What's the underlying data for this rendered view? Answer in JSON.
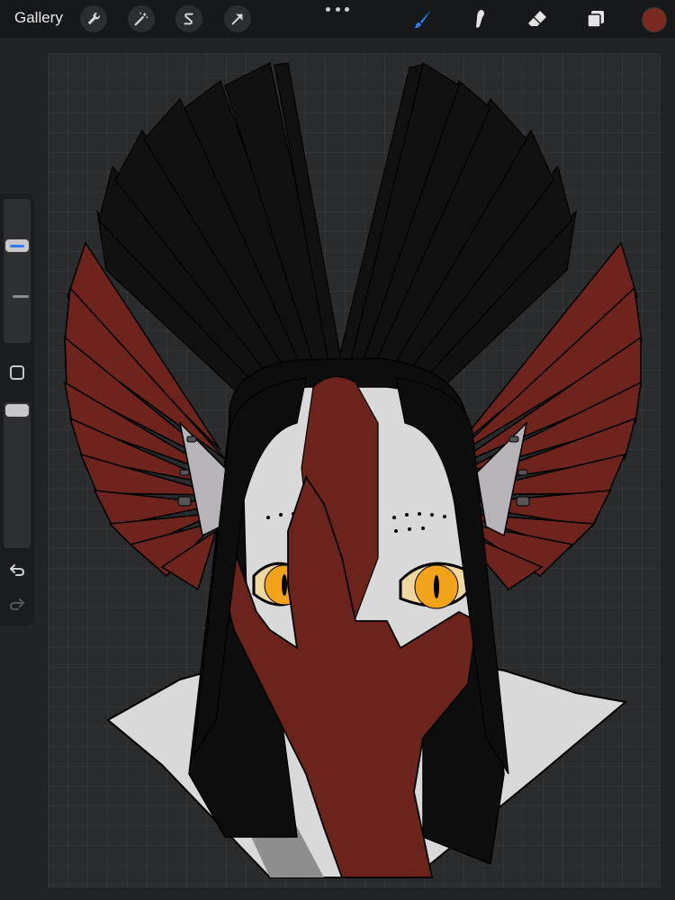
{
  "toolbar": {
    "gallery_label": "Gallery",
    "left_tools": [
      "wrench-icon",
      "magic-wand-icon",
      "selection-s-icon",
      "move-arrow-icon"
    ],
    "right_tools": [
      "brush-icon",
      "smudge-icon",
      "eraser-icon",
      "layers-icon"
    ],
    "active_tool": "brush",
    "active_tool_color": "#2f7bf5",
    "current_color": "#7a2a20"
  },
  "sidebar": {
    "brush_size_level": 0.3,
    "opacity_level": 0.0,
    "icons": [
      "modify-square-icon",
      "undo-icon",
      "redo-icon"
    ]
  },
  "artwork": {
    "colors": {
      "feathers_black": "#111111",
      "feathers_red": "#6e241c",
      "skin_red": "#6c231c",
      "face_white": "#d9d9d9",
      "hair": "#0d0d0d",
      "eyes": "#f3a21b",
      "ear": "#b7b3b9"
    }
  }
}
